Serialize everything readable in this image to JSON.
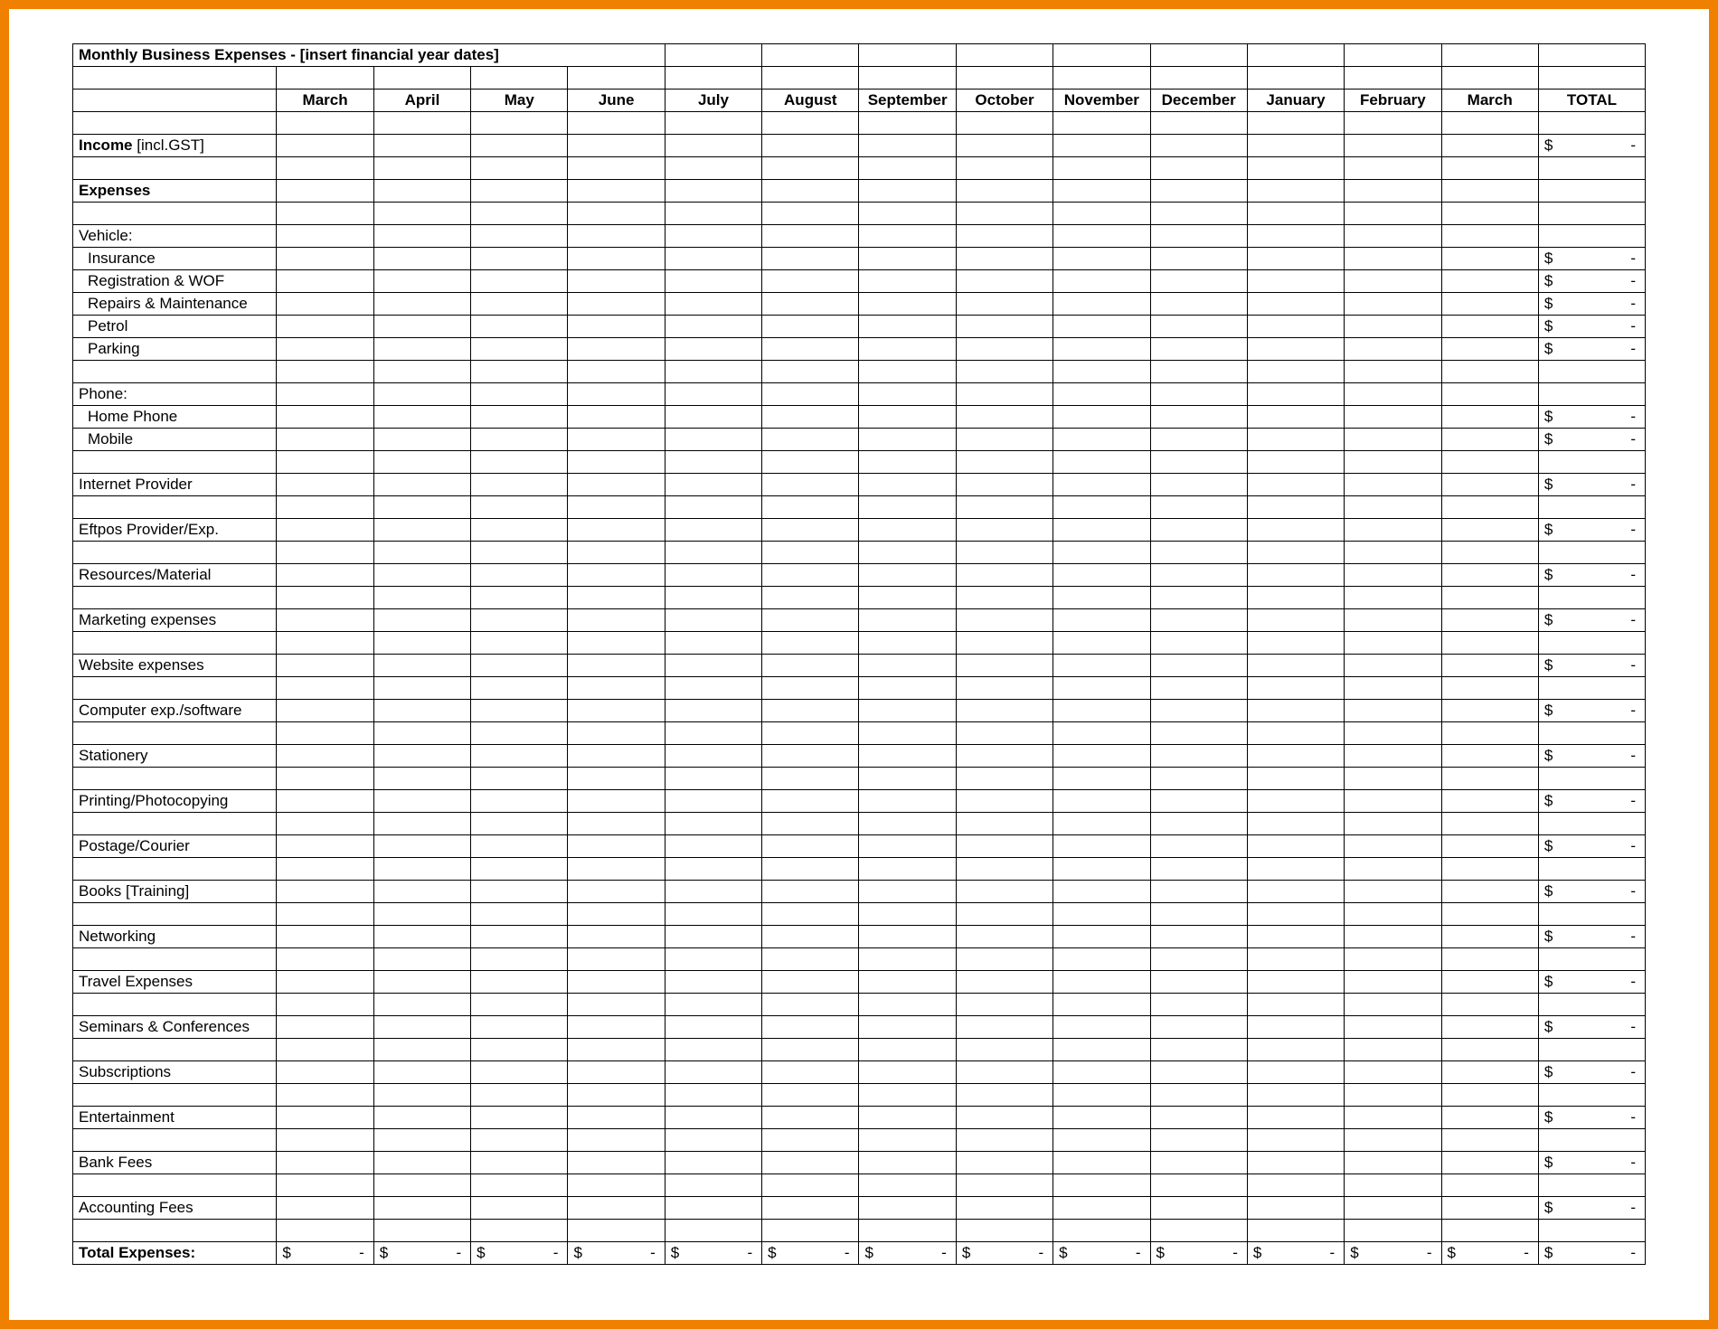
{
  "title": "Monthly Business Expenses - [insert financial year dates]",
  "months": [
    "March",
    "April",
    "May",
    "June",
    "July",
    "August",
    "September",
    "October",
    "November",
    "December",
    "January",
    "February",
    "March"
  ],
  "total_header": "TOTAL",
  "income_label_bold": "Income",
  "income_label_rest": " [incl.GST]",
  "expenses_header": "Expenses",
  "total_expenses_label": "Total Expenses:",
  "currency_symbol": "$",
  "empty_value": "-",
  "rows": [
    {
      "type": "section",
      "label": "Vehicle:"
    },
    {
      "type": "item",
      "label": "Insurance",
      "indent": true,
      "total": true
    },
    {
      "type": "item",
      "label": "Registration & WOF",
      "indent": true,
      "total": true
    },
    {
      "type": "item",
      "label": "Repairs & Maintenance",
      "indent": true,
      "total": true
    },
    {
      "type": "item",
      "label": "Petrol",
      "indent": true,
      "total": true
    },
    {
      "type": "item",
      "label": "Parking",
      "indent": true,
      "total": true
    },
    {
      "type": "blank"
    },
    {
      "type": "section",
      "label": "Phone:"
    },
    {
      "type": "item",
      "label": "Home Phone",
      "indent": true,
      "total": true
    },
    {
      "type": "item",
      "label": "Mobile",
      "indent": true,
      "total": true
    },
    {
      "type": "blank"
    },
    {
      "type": "item",
      "label": "Internet Provider",
      "total": true
    },
    {
      "type": "blank"
    },
    {
      "type": "item",
      "label": "Eftpos Provider/Exp.",
      "total": true
    },
    {
      "type": "blank"
    },
    {
      "type": "item",
      "label": "Resources/Material",
      "total": true
    },
    {
      "type": "blank"
    },
    {
      "type": "item",
      "label": "Marketing expenses",
      "total": true
    },
    {
      "type": "blank"
    },
    {
      "type": "item",
      "label": "Website expenses",
      "total": true
    },
    {
      "type": "blank"
    },
    {
      "type": "item",
      "label": "Computer exp./software",
      "total": true
    },
    {
      "type": "blank"
    },
    {
      "type": "item",
      "label": "Stationery",
      "total": true
    },
    {
      "type": "blank"
    },
    {
      "type": "item",
      "label": "Printing/Photocopying",
      "total": true
    },
    {
      "type": "blank"
    },
    {
      "type": "item",
      "label": "Postage/Courier",
      "total": true
    },
    {
      "type": "blank"
    },
    {
      "type": "item",
      "label": "Books [Training]",
      "total": true
    },
    {
      "type": "blank"
    },
    {
      "type": "item",
      "label": "Networking",
      "total": true
    },
    {
      "type": "blank"
    },
    {
      "type": "item",
      "label": "Travel Expenses",
      "total": true
    },
    {
      "type": "blank"
    },
    {
      "type": "item",
      "label": "Seminars & Conferences",
      "total": true
    },
    {
      "type": "blank"
    },
    {
      "type": "item",
      "label": "Subscriptions",
      "total": true
    },
    {
      "type": "blank"
    },
    {
      "type": "item",
      "label": "Entertainment",
      "total": true
    },
    {
      "type": "blank"
    },
    {
      "type": "item",
      "label": "Bank Fees",
      "total": true
    },
    {
      "type": "blank"
    },
    {
      "type": "item",
      "label": "Accounting Fees",
      "total": true
    },
    {
      "type": "blank"
    }
  ]
}
